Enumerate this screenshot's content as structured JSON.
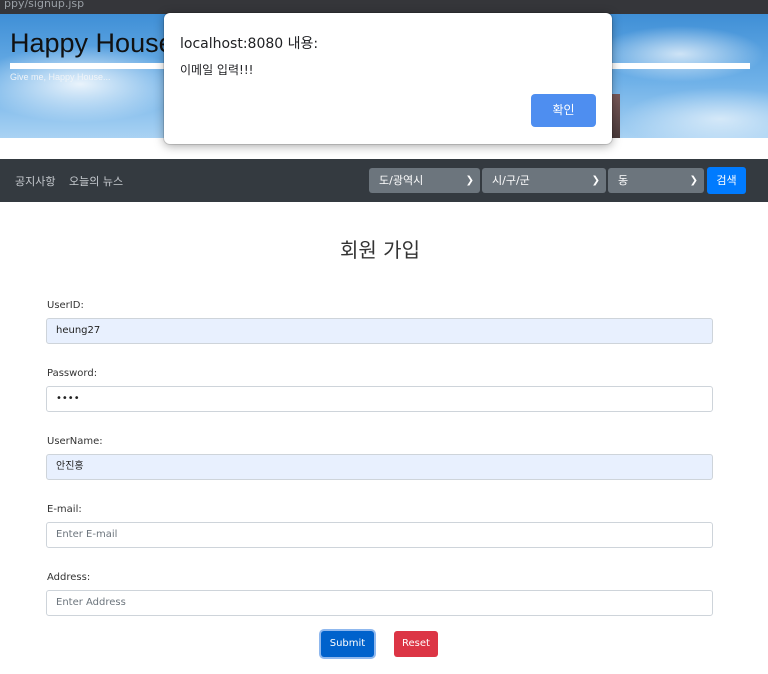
{
  "browser": {
    "url_fragment": "ppy/signup.jsp"
  },
  "header": {
    "title": "Happy House",
    "subtitle": "Give me, Happy House..."
  },
  "navbar": {
    "links": [
      "공지사항",
      "오늘의 뉴스"
    ],
    "selects": [
      {
        "value": "도/광역시",
        "icon": "chevron-down-icon"
      },
      {
        "value": "시/구/군",
        "icon": "chevron-down-icon"
      },
      {
        "value": "동",
        "icon": "chevron-down-icon"
      }
    ],
    "search_label": "검색"
  },
  "form": {
    "title": "회원 가입",
    "fields": [
      {
        "label": "UserID:",
        "value": "heung27",
        "placeholder": ""
      },
      {
        "label": "Password:",
        "value": "••••",
        "placeholder": ""
      },
      {
        "label": "UserName:",
        "value": "안진홍",
        "placeholder": ""
      },
      {
        "label": "E-mail:",
        "value": "",
        "placeholder": "Enter E-mail"
      },
      {
        "label": "Address:",
        "value": "",
        "placeholder": "Enter Address"
      }
    ],
    "submit_label": "Submit",
    "reset_label": "Reset"
  },
  "alert": {
    "title": "localhost:8080 내용:",
    "message": "이메일 입력!!!",
    "ok_label": "확인"
  },
  "colors": {
    "navbar": "#343a40",
    "primary": "#007bff",
    "danger": "#dc3545",
    "autofill": "#e8f0fe"
  }
}
